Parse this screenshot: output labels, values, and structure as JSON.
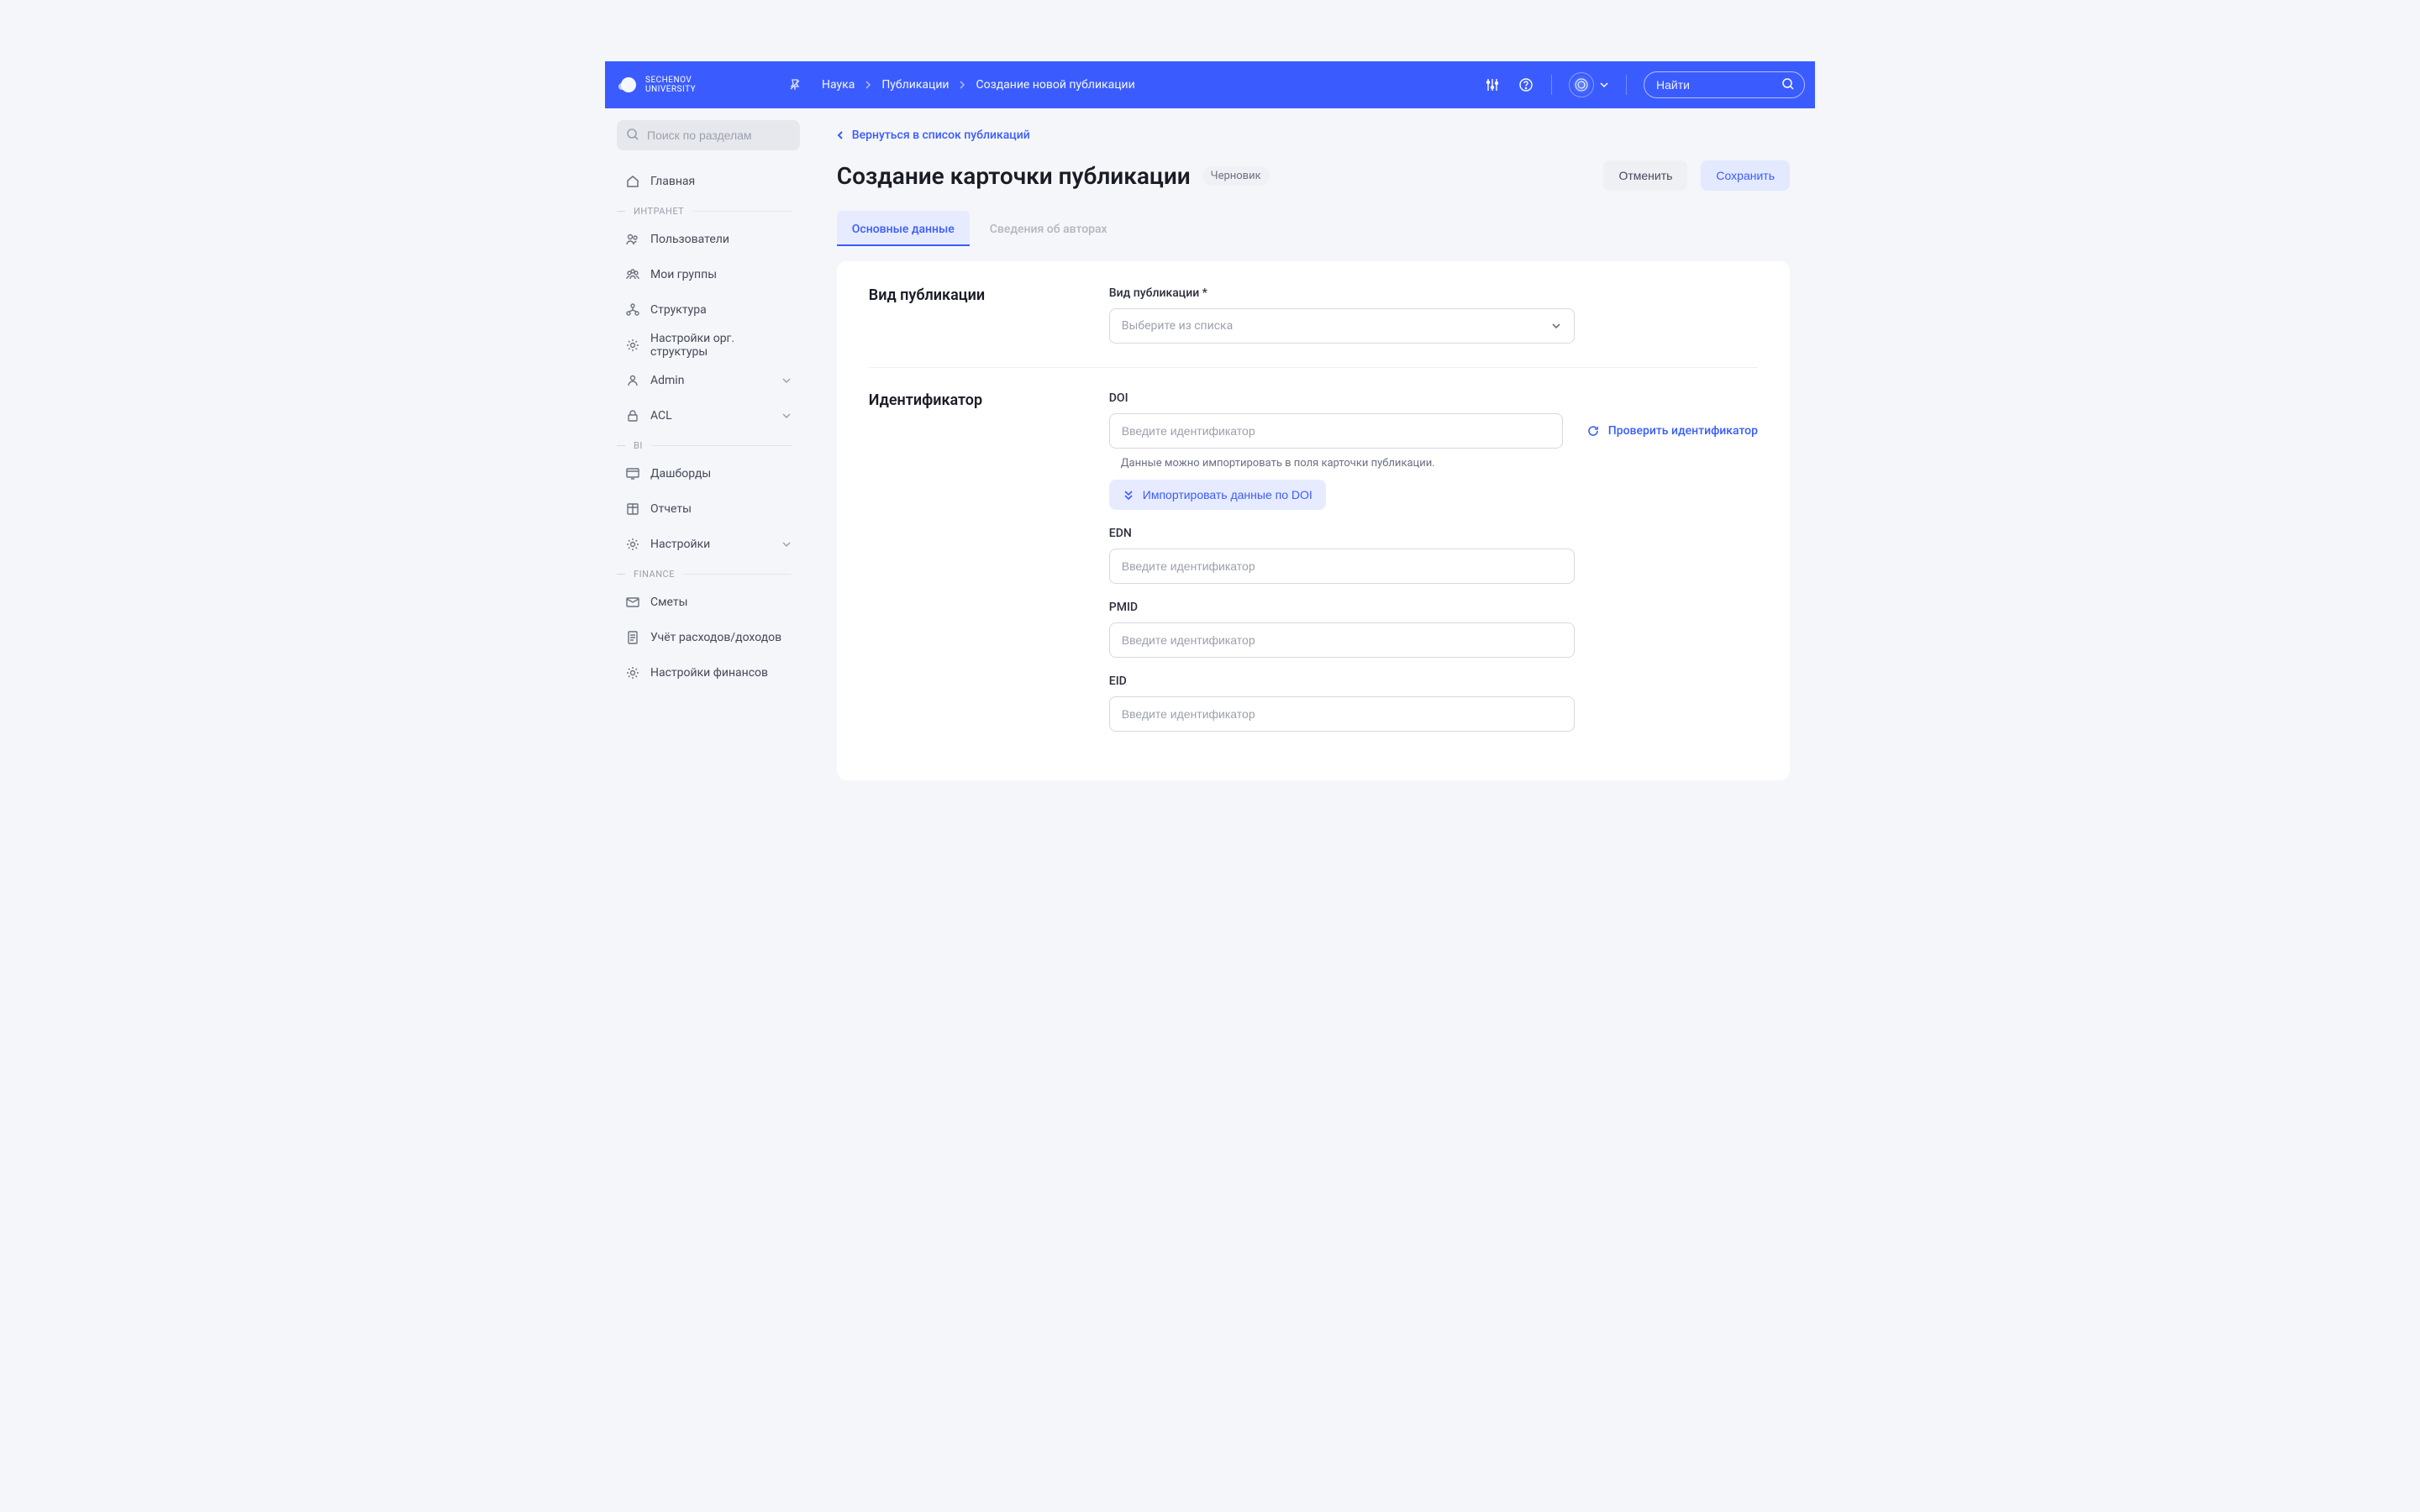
{
  "header": {
    "logo_line1": "SECHENOV",
    "logo_line2": "UNIVERSITY",
    "breadcrumb": [
      "Наука",
      "Публикации",
      "Создание новой публикации"
    ],
    "search_placeholder": "Найти"
  },
  "sidebar": {
    "search_placeholder": "Поиск по разделам",
    "home": "Главная",
    "sections": {
      "intranet": {
        "label": "ИНТРАНЕТ",
        "items": [
          "Пользователи",
          "Мои группы",
          "Структура",
          "Настройки орг. структуры",
          "Admin",
          "ACL"
        ]
      },
      "bi": {
        "label": "BI",
        "items": [
          "Дашборды",
          "Отчеты",
          "Настройки"
        ]
      },
      "finance": {
        "label": "FINANCE",
        "items": [
          "Сметы",
          "Учёт расходов/доходов",
          "Настройки финансов"
        ]
      }
    }
  },
  "main": {
    "back": "Вернуться в список публикаций",
    "title": "Создание карточки публикации",
    "status": "Черновик",
    "cancel": "Отменить",
    "save": "Сохранить",
    "tabs": [
      "Основные данные",
      "Сведения об авторах"
    ],
    "pub_type_section": "Вид публикации",
    "pub_type_label": "Вид публикации",
    "pub_type_placeholder": "Выберите из списка",
    "identifier_section": "Идентификатор",
    "doi_label": "DOI",
    "id_placeholder": "Введите идентификатор",
    "doi_hint": "Данные можно импортировать в поля карточки публикации.",
    "import_btn": "Импортировать данные по DOI",
    "check_link": "Проверить идентификатор",
    "edn_label": "EDN",
    "pmid_label": "PMID",
    "eid_label": "EID"
  }
}
